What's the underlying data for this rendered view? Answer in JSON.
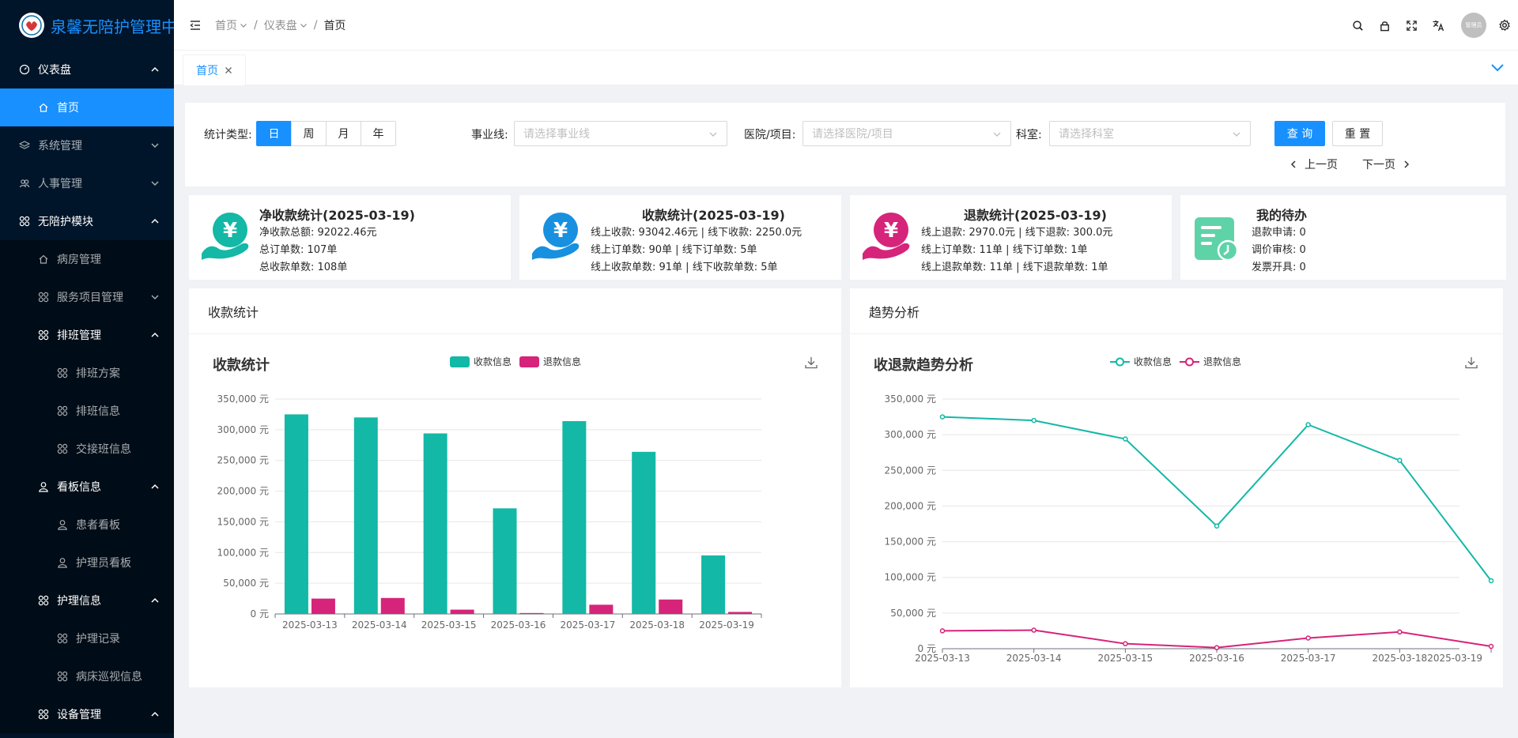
{
  "app": {
    "title": "泉馨无陪护管理中心"
  },
  "sidebar": {
    "items": [
      {
        "label": "仪表盘"
      },
      {
        "label": "首页"
      },
      {
        "label": "系统管理"
      },
      {
        "label": "人事管理"
      },
      {
        "label": "无陪护模块"
      },
      {
        "label": "病房管理"
      },
      {
        "label": "服务项目管理"
      },
      {
        "label": "排班管理"
      },
      {
        "label": "排班方案"
      },
      {
        "label": "排班信息"
      },
      {
        "label": "交接班信息"
      },
      {
        "label": "看板信息"
      },
      {
        "label": "患者看板"
      },
      {
        "label": "护理员看板"
      },
      {
        "label": "护理信息"
      },
      {
        "label": "护理记录"
      },
      {
        "label": "病床巡视信息"
      },
      {
        "label": "设备管理"
      }
    ]
  },
  "header": {
    "breadcrumb": [
      "首页",
      "仪表盘",
      "首页"
    ],
    "separator": "/",
    "avatar_text": "管理员"
  },
  "tabs": [
    {
      "label": "首页"
    }
  ],
  "filter": {
    "type_label": "统计类型:",
    "types": [
      "日",
      "周",
      "月",
      "年"
    ],
    "business_label": "事业线:",
    "business_placeholder": "请选择事业线",
    "hospital_label": "医院/项目:",
    "hospital_placeholder": "请选择医院/项目",
    "dept_label": "科室:",
    "dept_placeholder": "请选择科室",
    "query_label": "查 询",
    "reset_label": "重 置",
    "prev_label": "上一页",
    "next_label": "下一页"
  },
  "cards": {
    "net": {
      "title": "净收款统计(2025-03-19)",
      "lines": [
        "净收款总额:  92022.46元",
        "总订单数:  107单",
        "总收款单数:  108单"
      ]
    },
    "income": {
      "title": "收款统计(2025-03-19)",
      "lines": [
        "线上收款:   93042.46元  |  线下收款:  2250.0元",
        "线上订单数:  90单  |  线下订单数:  5单",
        "线上收款单数:  91单  |  线下收款单数:  5单"
      ]
    },
    "refund": {
      "title": "退款统计(2025-03-19)",
      "lines": [
        "线上退款:  2970.0元  |  线下退款:  300.0元",
        "线上订单数:  11单  |  线下订单数:  1单",
        "线上退款单数:  11单  |  线下退款单数:  1单"
      ]
    },
    "todo": {
      "title": "我的待办",
      "lines": [
        "退款申请:  0",
        "调价审核:  0",
        "发票开具:  0"
      ]
    }
  },
  "panels": {
    "left_header": "收款统计",
    "right_header": "趋势分析"
  },
  "colors": {
    "income": "#13b8a6",
    "refund": "#d6247a",
    "primary": "#1890ff",
    "sidebar_bg": "#001529"
  },
  "chart_data": [
    {
      "type": "bar",
      "title": "收款统计",
      "categories": [
        "2025-03-13",
        "2025-03-14",
        "2025-03-15",
        "2025-03-16",
        "2025-03-17",
        "2025-03-18",
        "2025-03-19"
      ],
      "series": [
        {
          "name": "收款信息",
          "values": [
            325000,
            320000,
            294000,
            172000,
            314000,
            264000,
            95300
          ]
        },
        {
          "name": "退款信息",
          "values": [
            25000,
            26000,
            7000,
            1500,
            15000,
            23500,
            3270
          ]
        }
      ],
      "ylim": [
        0,
        350000
      ],
      "yticks": [
        "0 元",
        "50,000 元",
        "100,000 元",
        "150,000 元",
        "200,000 元",
        "250,000 元",
        "300,000 元",
        "350,000 元"
      ],
      "legend": "top-center",
      "grid": true
    },
    {
      "type": "line",
      "title": "收退款趋势分析",
      "categories": [
        "2025-03-13",
        "2025-03-14",
        "2025-03-15",
        "2025-03-16",
        "2025-03-17",
        "2025-03-18",
        "2025-03-19"
      ],
      "series": [
        {
          "name": "收款信息",
          "values": [
            325000,
            320000,
            294000,
            172000,
            314000,
            264000,
            95300
          ]
        },
        {
          "name": "退款信息",
          "values": [
            25000,
            26000,
            7000,
            1500,
            15000,
            23500,
            3270
          ]
        }
      ],
      "ylim": [
        0,
        350000
      ],
      "yticks": [
        "0 元",
        "50,000 元",
        "100,000 元",
        "150,000 元",
        "200,000 元",
        "250,000 元",
        "300,000 元",
        "350,000 元"
      ],
      "legend": "top-center",
      "grid": true
    }
  ]
}
